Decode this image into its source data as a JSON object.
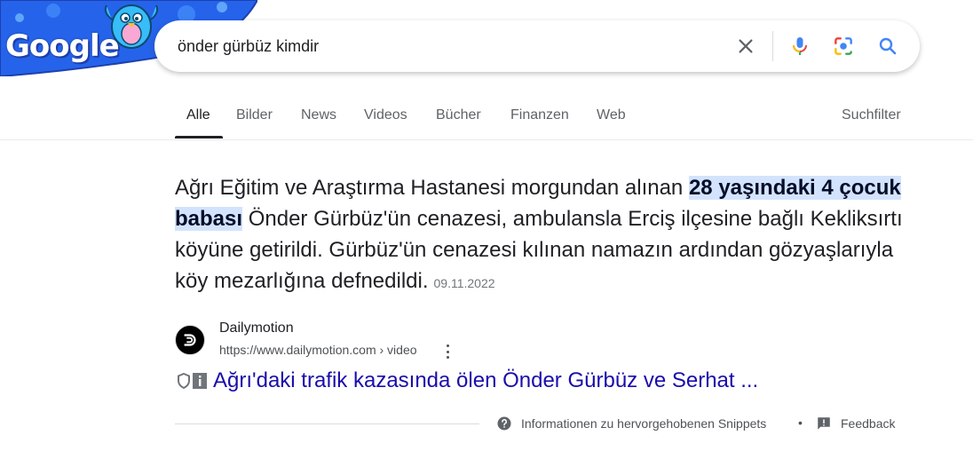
{
  "logo": {
    "text": "Google"
  },
  "search": {
    "query": "önder gürbüz kimdir",
    "icons": [
      "clear-icon",
      "microphone-icon",
      "camera-lens-icon",
      "search-icon"
    ]
  },
  "tabs": [
    {
      "label": "Alle",
      "active": true
    },
    {
      "label": "Bilder"
    },
    {
      "label": "News"
    },
    {
      "label": "Videos"
    },
    {
      "label": "Bücher"
    },
    {
      "label": "Finanzen"
    },
    {
      "label": "Web"
    }
  ],
  "search_filter": "Suchfilter",
  "snippet": {
    "before": "Ağrı Eğitim ve Araştırma Hastanesi morgundan alınan ",
    "highlight": "28 yaşındaki 4 çocuk babası",
    "after": " Önder Gürbüz'ün cenazesi, ambulansla Erciş ilçesine bağlı Kekliksırtı köyüne getirildi. Gürbüz'ün cenazesi kılınan namazın ardından gözyaşlarıyla köy mezarlığına defnedildi.",
    "date": "09.11.2022"
  },
  "source": {
    "name": "Dailymotion",
    "url": "https://www.dailymotion.com › video",
    "favicon": "dailymotion-logo-icon"
  },
  "result": {
    "title": "Ağrı'daki trafik kazasında ölen Önder Gürbüz ve Serhat ..."
  },
  "footer": {
    "info": "Informationen zu hervorgehobenen Snippets",
    "separator": "•",
    "feedback": "Feedback"
  },
  "colors": {
    "link": "#1a0dab",
    "highlight": "#d3e3fd",
    "doodle_blue": "#2563eb"
  }
}
